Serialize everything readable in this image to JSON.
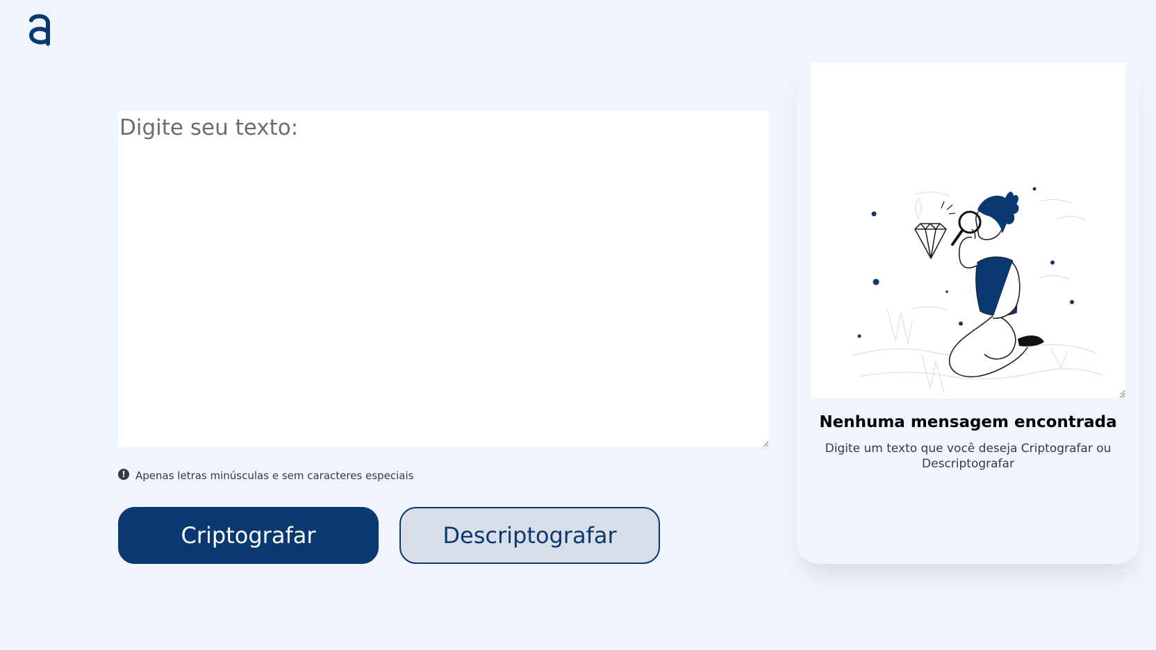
{
  "logo": {
    "icon": "logo-a-icon",
    "color": "#0a3871"
  },
  "input": {
    "placeholder": "Digite seu texto:",
    "value": ""
  },
  "hint": {
    "icon": "exclamation-circle-icon",
    "text": "Apenas letras minúsculas e sem caracteres especiais"
  },
  "buttons": {
    "encrypt_label": "Criptografar",
    "decrypt_label": "Descriptografar"
  },
  "output_card": {
    "image": "person-with-magnifying-glass-illustration",
    "title": "Nenhuma mensagem encontrada",
    "subtitle": "Digite um texto que você deseja Criptografar ou Descriptografar"
  },
  "colors": {
    "primary": "#0a3871",
    "background": "#f0f4fc",
    "secondary_button": "#d8dfe8",
    "text": "#343a40"
  }
}
